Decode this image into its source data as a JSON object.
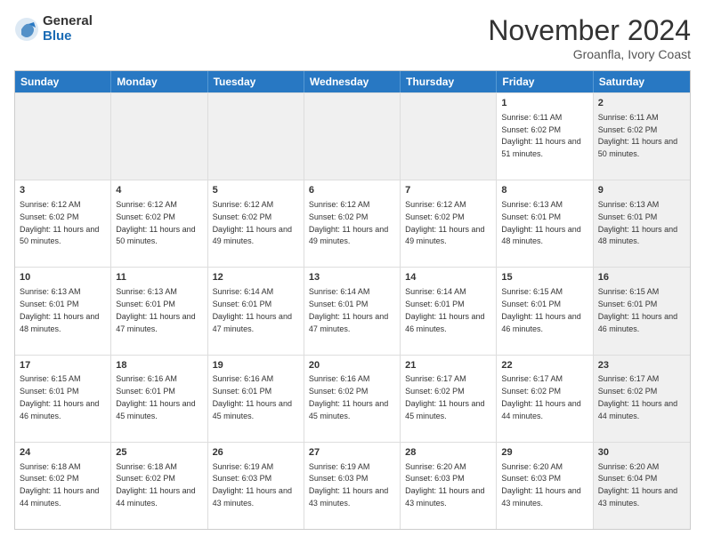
{
  "logo": {
    "general": "General",
    "blue": "Blue"
  },
  "title": "November 2024",
  "location": "Groanfla, Ivory Coast",
  "header_days": [
    "Sunday",
    "Monday",
    "Tuesday",
    "Wednesday",
    "Thursday",
    "Friday",
    "Saturday"
  ],
  "weeks": [
    {
      "cells": [
        {
          "day": "",
          "info": "",
          "shaded": true
        },
        {
          "day": "",
          "info": "",
          "shaded": true
        },
        {
          "day": "",
          "info": "",
          "shaded": true
        },
        {
          "day": "",
          "info": "",
          "shaded": true
        },
        {
          "day": "",
          "info": "",
          "shaded": true
        },
        {
          "day": "1",
          "info": "Sunrise: 6:11 AM\nSunset: 6:02 PM\nDaylight: 11 hours and 51 minutes.",
          "shaded": false
        },
        {
          "day": "2",
          "info": "Sunrise: 6:11 AM\nSunset: 6:02 PM\nDaylight: 11 hours and 50 minutes.",
          "shaded": true
        }
      ]
    },
    {
      "cells": [
        {
          "day": "3",
          "info": "Sunrise: 6:12 AM\nSunset: 6:02 PM\nDaylight: 11 hours and 50 minutes.",
          "shaded": false
        },
        {
          "day": "4",
          "info": "Sunrise: 6:12 AM\nSunset: 6:02 PM\nDaylight: 11 hours and 50 minutes.",
          "shaded": false
        },
        {
          "day": "5",
          "info": "Sunrise: 6:12 AM\nSunset: 6:02 PM\nDaylight: 11 hours and 49 minutes.",
          "shaded": false
        },
        {
          "day": "6",
          "info": "Sunrise: 6:12 AM\nSunset: 6:02 PM\nDaylight: 11 hours and 49 minutes.",
          "shaded": false
        },
        {
          "day": "7",
          "info": "Sunrise: 6:12 AM\nSunset: 6:02 PM\nDaylight: 11 hours and 49 minutes.",
          "shaded": false
        },
        {
          "day": "8",
          "info": "Sunrise: 6:13 AM\nSunset: 6:01 PM\nDaylight: 11 hours and 48 minutes.",
          "shaded": false
        },
        {
          "day": "9",
          "info": "Sunrise: 6:13 AM\nSunset: 6:01 PM\nDaylight: 11 hours and 48 minutes.",
          "shaded": true
        }
      ]
    },
    {
      "cells": [
        {
          "day": "10",
          "info": "Sunrise: 6:13 AM\nSunset: 6:01 PM\nDaylight: 11 hours and 48 minutes.",
          "shaded": false
        },
        {
          "day": "11",
          "info": "Sunrise: 6:13 AM\nSunset: 6:01 PM\nDaylight: 11 hours and 47 minutes.",
          "shaded": false
        },
        {
          "day": "12",
          "info": "Sunrise: 6:14 AM\nSunset: 6:01 PM\nDaylight: 11 hours and 47 minutes.",
          "shaded": false
        },
        {
          "day": "13",
          "info": "Sunrise: 6:14 AM\nSunset: 6:01 PM\nDaylight: 11 hours and 47 minutes.",
          "shaded": false
        },
        {
          "day": "14",
          "info": "Sunrise: 6:14 AM\nSunset: 6:01 PM\nDaylight: 11 hours and 46 minutes.",
          "shaded": false
        },
        {
          "day": "15",
          "info": "Sunrise: 6:15 AM\nSunset: 6:01 PM\nDaylight: 11 hours and 46 minutes.",
          "shaded": false
        },
        {
          "day": "16",
          "info": "Sunrise: 6:15 AM\nSunset: 6:01 PM\nDaylight: 11 hours and 46 minutes.",
          "shaded": true
        }
      ]
    },
    {
      "cells": [
        {
          "day": "17",
          "info": "Sunrise: 6:15 AM\nSunset: 6:01 PM\nDaylight: 11 hours and 46 minutes.",
          "shaded": false
        },
        {
          "day": "18",
          "info": "Sunrise: 6:16 AM\nSunset: 6:01 PM\nDaylight: 11 hours and 45 minutes.",
          "shaded": false
        },
        {
          "day": "19",
          "info": "Sunrise: 6:16 AM\nSunset: 6:01 PM\nDaylight: 11 hours and 45 minutes.",
          "shaded": false
        },
        {
          "day": "20",
          "info": "Sunrise: 6:16 AM\nSunset: 6:02 PM\nDaylight: 11 hours and 45 minutes.",
          "shaded": false
        },
        {
          "day": "21",
          "info": "Sunrise: 6:17 AM\nSunset: 6:02 PM\nDaylight: 11 hours and 45 minutes.",
          "shaded": false
        },
        {
          "day": "22",
          "info": "Sunrise: 6:17 AM\nSunset: 6:02 PM\nDaylight: 11 hours and 44 minutes.",
          "shaded": false
        },
        {
          "day": "23",
          "info": "Sunrise: 6:17 AM\nSunset: 6:02 PM\nDaylight: 11 hours and 44 minutes.",
          "shaded": true
        }
      ]
    },
    {
      "cells": [
        {
          "day": "24",
          "info": "Sunrise: 6:18 AM\nSunset: 6:02 PM\nDaylight: 11 hours and 44 minutes.",
          "shaded": false
        },
        {
          "day": "25",
          "info": "Sunrise: 6:18 AM\nSunset: 6:02 PM\nDaylight: 11 hours and 44 minutes.",
          "shaded": false
        },
        {
          "day": "26",
          "info": "Sunrise: 6:19 AM\nSunset: 6:03 PM\nDaylight: 11 hours and 43 minutes.",
          "shaded": false
        },
        {
          "day": "27",
          "info": "Sunrise: 6:19 AM\nSunset: 6:03 PM\nDaylight: 11 hours and 43 minutes.",
          "shaded": false
        },
        {
          "day": "28",
          "info": "Sunrise: 6:20 AM\nSunset: 6:03 PM\nDaylight: 11 hours and 43 minutes.",
          "shaded": false
        },
        {
          "day": "29",
          "info": "Sunrise: 6:20 AM\nSunset: 6:03 PM\nDaylight: 11 hours and 43 minutes.",
          "shaded": false
        },
        {
          "day": "30",
          "info": "Sunrise: 6:20 AM\nSunset: 6:04 PM\nDaylight: 11 hours and 43 minutes.",
          "shaded": true
        }
      ]
    }
  ]
}
